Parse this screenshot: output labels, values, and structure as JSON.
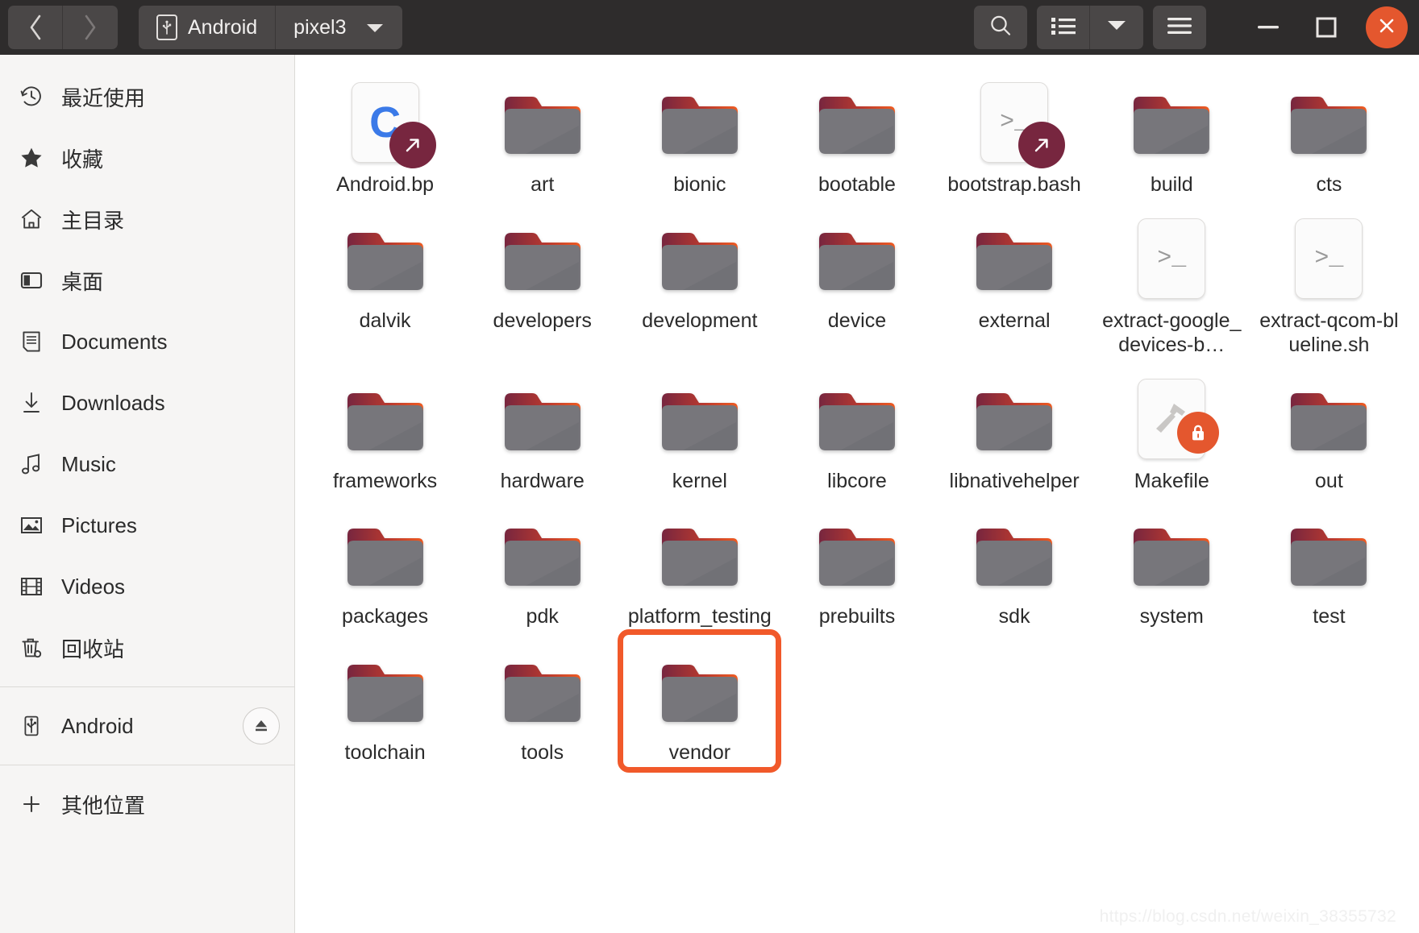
{
  "window": {
    "nav": {
      "back_label": "Back",
      "forward_label": "Forward"
    },
    "breadcrumb": [
      {
        "label": "Android",
        "icon": "usb-device-icon"
      },
      {
        "label": "pixel3",
        "icon": "chevron-down-icon"
      }
    ],
    "toolbar": {
      "search_label": "Search",
      "view_list_label": "List view",
      "view_options_label": "View options",
      "menu_label": "Menu"
    },
    "controls": {
      "minimize_label": "Minimize",
      "maximize_label": "Maximize",
      "close_label": "Close"
    },
    "accent_close": "#e4572e"
  },
  "sidebar": {
    "items": [
      {
        "label": "最近使用",
        "icon": "clock-recent-icon"
      },
      {
        "label": "收藏",
        "icon": "star-icon"
      },
      {
        "label": "主目录",
        "icon": "home-icon"
      },
      {
        "label": "桌面",
        "icon": "desktop-icon"
      },
      {
        "label": "Documents",
        "icon": "document-icon"
      },
      {
        "label": "Downloads",
        "icon": "download-arrow-icon"
      },
      {
        "label": "Music",
        "icon": "music-note-icon"
      },
      {
        "label": "Pictures",
        "icon": "picture-icon"
      },
      {
        "label": "Videos",
        "icon": "film-icon"
      },
      {
        "label": "回收站",
        "icon": "trash-icon"
      }
    ],
    "device": {
      "label": "Android",
      "icon": "usb-device-icon",
      "eject_label": "Eject"
    },
    "other": {
      "label": "其他位置",
      "icon": "plus-icon"
    }
  },
  "files": {
    "highlighted": "vendor",
    "items": [
      {
        "name": "Android.bp",
        "type": "code",
        "glyph": "C",
        "badge": "symlink"
      },
      {
        "name": "art",
        "type": "folder",
        "badge": null
      },
      {
        "name": "bionic",
        "type": "folder",
        "badge": null
      },
      {
        "name": "bootable",
        "type": "folder",
        "badge": null
      },
      {
        "name": "bootstrap.bash",
        "type": "script",
        "glyph": ">_",
        "badge": "symlink"
      },
      {
        "name": "build",
        "type": "folder",
        "badge": null
      },
      {
        "name": "cts",
        "type": "folder",
        "badge": null
      },
      {
        "name": "dalvik",
        "type": "folder",
        "badge": null
      },
      {
        "name": "developers",
        "type": "folder",
        "badge": null
      },
      {
        "name": "development",
        "type": "folder",
        "badge": null
      },
      {
        "name": "device",
        "type": "folder",
        "badge": null
      },
      {
        "name": "external",
        "type": "folder",
        "badge": null
      },
      {
        "name": "extract-google_devices-b…",
        "type": "script",
        "glyph": ">_",
        "badge": null
      },
      {
        "name": "extract-qcom-blueline.sh",
        "type": "script",
        "glyph": ">_",
        "badge": null
      },
      {
        "name": "frameworks",
        "type": "folder",
        "badge": null
      },
      {
        "name": "hardware",
        "type": "folder",
        "badge": null
      },
      {
        "name": "kernel",
        "type": "folder",
        "badge": null
      },
      {
        "name": "libcore",
        "type": "folder",
        "badge": null
      },
      {
        "name": "libnativehelper",
        "type": "folder",
        "badge": null
      },
      {
        "name": "Makefile",
        "type": "makefile",
        "glyph": "hammer",
        "badge": "lock"
      },
      {
        "name": "out",
        "type": "folder",
        "badge": null
      },
      {
        "name": "packages",
        "type": "folder",
        "badge": null
      },
      {
        "name": "pdk",
        "type": "folder",
        "badge": null
      },
      {
        "name": "platform_testing",
        "type": "folder",
        "badge": null
      },
      {
        "name": "prebuilts",
        "type": "folder",
        "badge": null
      },
      {
        "name": "sdk",
        "type": "folder",
        "badge": null
      },
      {
        "name": "system",
        "type": "folder",
        "badge": null
      },
      {
        "name": "test",
        "type": "folder",
        "badge": null
      },
      {
        "name": "toolchain",
        "type": "folder",
        "badge": null
      },
      {
        "name": "tools",
        "type": "folder",
        "badge": null
      },
      {
        "name": "vendor",
        "type": "folder",
        "badge": null
      }
    ]
  },
  "watermark": {
    "text": "https://blog.csdn.net/weixin_38355732"
  }
}
